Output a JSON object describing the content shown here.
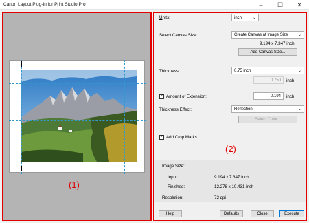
{
  "window": {
    "title": "Canon Layout Plug-In for Print Studio Pro"
  },
  "window_controls": {
    "minimize": "–",
    "maximize": "☐",
    "close": "✕"
  },
  "callouts": {
    "preview": "(1)",
    "settings": "(2)"
  },
  "colors": {
    "callout": "#e10000",
    "guide": "#3399cc",
    "primary_border": "#0078d7"
  },
  "settings": {
    "units": {
      "label": "Units:",
      "label_u": "U",
      "label_rest": "nits:",
      "value": "inch"
    },
    "canvas_size": {
      "label": "Select Canvas Size:",
      "value": "Create Canvas at Image Size",
      "dimensions": "9.194 x 7.347 inch",
      "add_button": "Add Canvas Size..."
    },
    "thickness": {
      "label": "Thickness:",
      "value": "0.75 inch",
      "custom_value": "0.750",
      "unit": "inch"
    },
    "extension": {
      "label": "Amount of Extension:",
      "checked": true,
      "value": "0.194",
      "unit": "inch"
    },
    "thickness_effect": {
      "label": "Thickness Effect:",
      "value": "Reflection",
      "select_color_button": "Select Color..."
    },
    "crop_marks": {
      "label": "Add Crop Marks",
      "checked": true
    }
  },
  "image_size": {
    "heading": "Image Size:",
    "input_label": "Input:",
    "input_value": "9.194 x 7.347 inch",
    "finished_label": "Finished:",
    "finished_value": "12.278 x 10.431 inch",
    "resolution_label": "Resolution:",
    "resolution_value": "72 dpi"
  },
  "buttons": {
    "help": "Help",
    "defaults": "Defaults",
    "close": "Close",
    "execute": "Execute"
  }
}
